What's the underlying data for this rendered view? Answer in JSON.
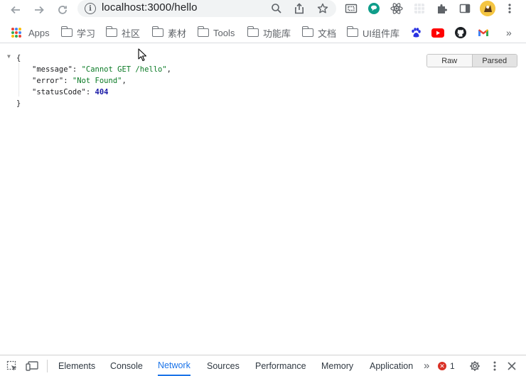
{
  "browser": {
    "url": "localhost:3000/hello"
  },
  "bookmarks": [
    {
      "label": "Apps",
      "icon": "apps-grid-icon"
    },
    {
      "label": "学习",
      "icon": "folder-icon"
    },
    {
      "label": "社区",
      "icon": "folder-icon"
    },
    {
      "label": "素材",
      "icon": "folder-icon"
    },
    {
      "label": "Tools",
      "icon": "folder-icon"
    },
    {
      "label": "功能库",
      "icon": "folder-icon"
    },
    {
      "label": "文档",
      "icon": "folder-icon"
    },
    {
      "label": "UI组件库",
      "icon": "folder-icon"
    }
  ],
  "bookmarks_more": "»",
  "json_view": {
    "open_brace": "{",
    "close_brace": "}",
    "entries": [
      {
        "key": "\"message\"",
        "sep": ": ",
        "value": "\"Cannot GET /hello\"",
        "tail": ",",
        "type": "string"
      },
      {
        "key": "\"error\"",
        "sep": ": ",
        "value": "\"Not Found\"",
        "tail": ",",
        "type": "string"
      },
      {
        "key": "\"statusCode\"",
        "sep": ": ",
        "value": "404",
        "tail": "",
        "type": "number"
      }
    ],
    "toggle": {
      "raw": "Raw",
      "parsed": "Parsed",
      "selected": "Parsed"
    }
  },
  "devtools": {
    "tabs": [
      {
        "label": "Elements",
        "active": false
      },
      {
        "label": "Console",
        "active": false
      },
      {
        "label": "Network",
        "active": true
      },
      {
        "label": "Sources",
        "active": false
      },
      {
        "label": "Performance",
        "active": false
      },
      {
        "label": "Memory",
        "active": false
      },
      {
        "label": "Application",
        "active": false
      }
    ],
    "more": "»",
    "error_count": "1"
  },
  "colors": {
    "accent": "#1a73e8",
    "json_string": "#0a7a25",
    "json_number": "#1a1aa6",
    "error": "#d93025"
  }
}
